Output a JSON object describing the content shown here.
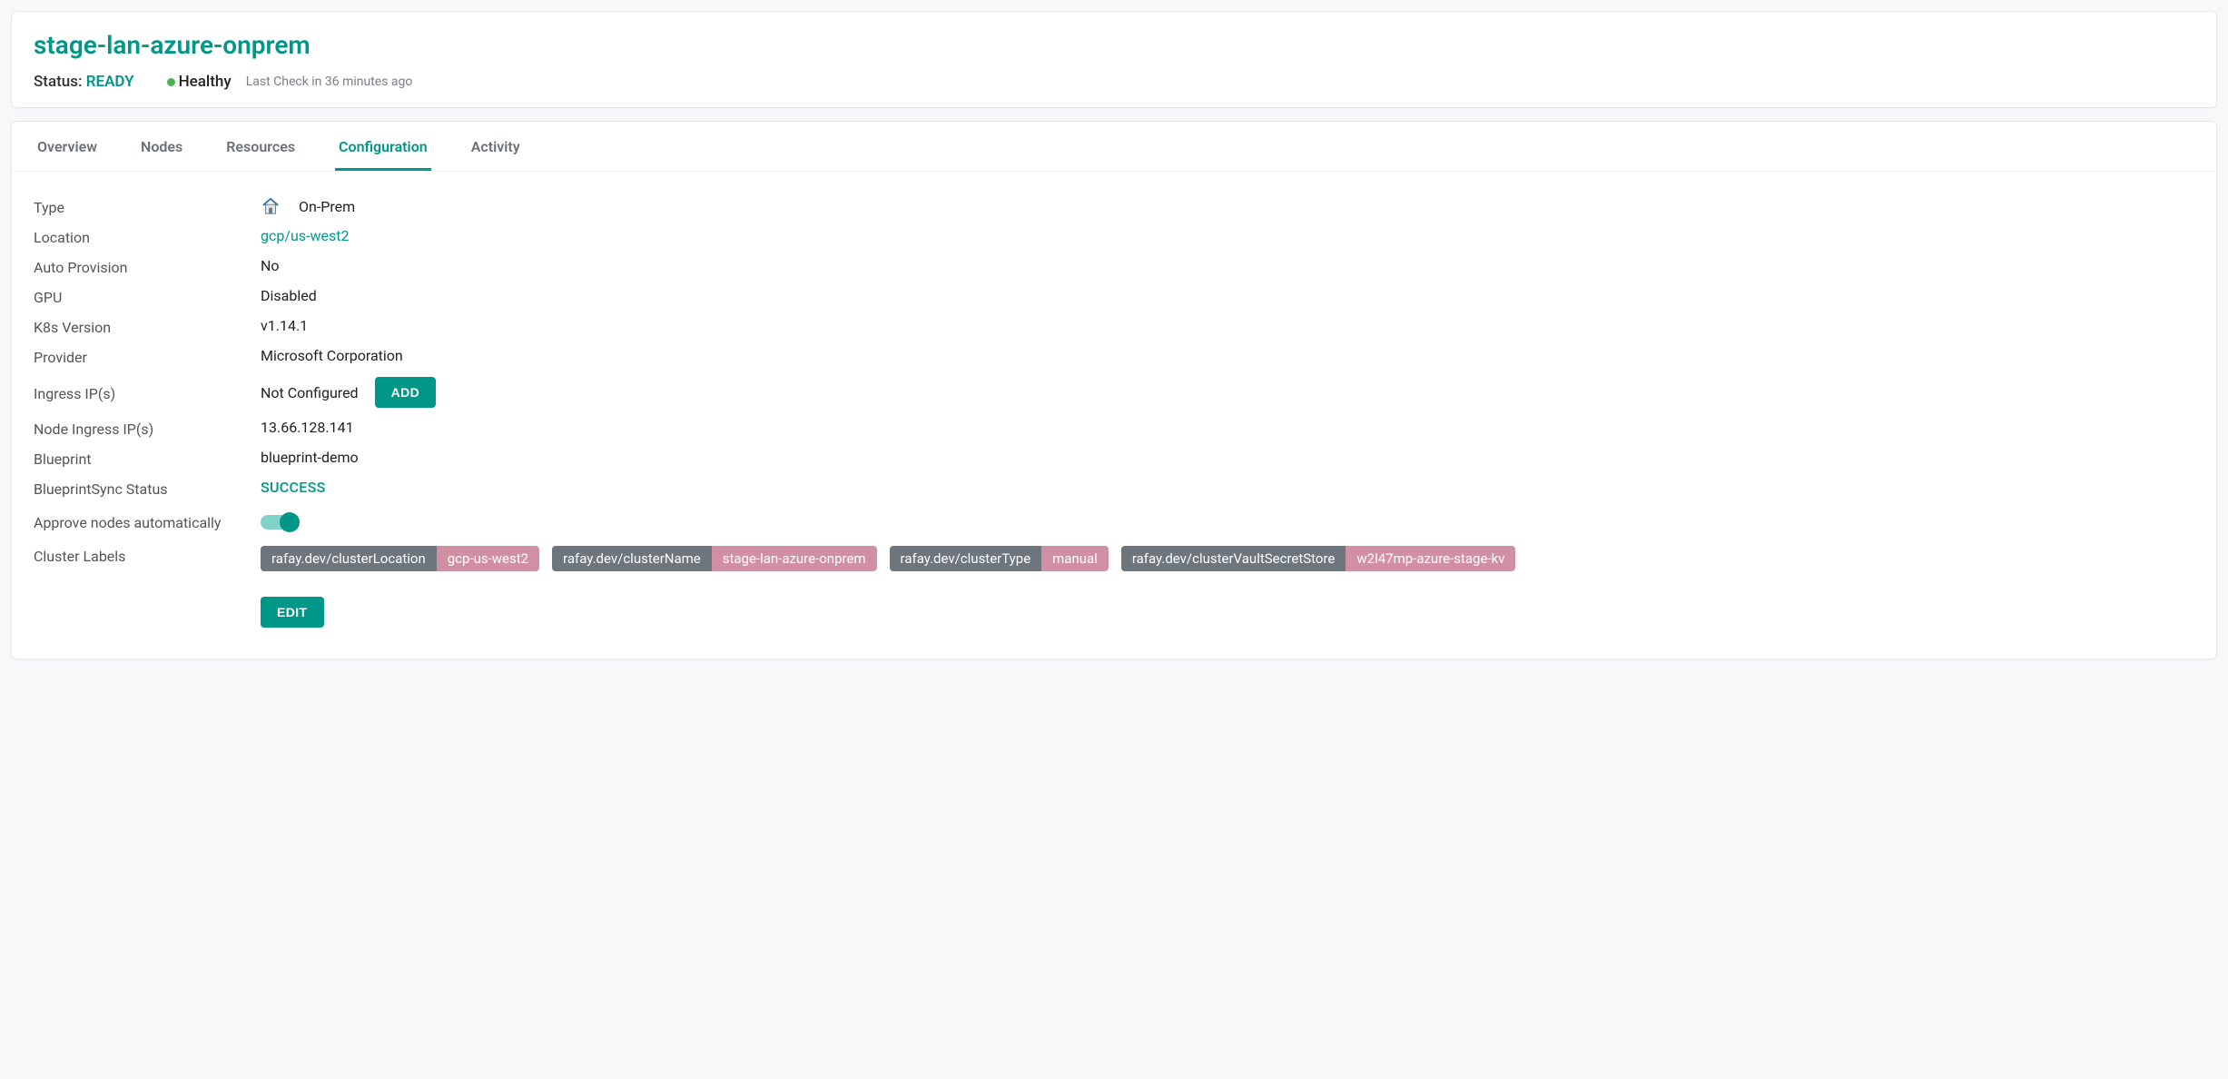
{
  "header": {
    "clusterName": "stage-lan-azure-onprem",
    "statusLabel": "Status:",
    "statusValue": "READY",
    "healthText": "Healthy",
    "lastCheck": "Last Check in 36 minutes ago"
  },
  "tabs": {
    "overview": "Overview",
    "nodes": "Nodes",
    "resources": "Resources",
    "configuration": "Configuration",
    "activity": "Activity"
  },
  "config": {
    "typeLabel": "Type",
    "typeValue": "On-Prem",
    "locationLabel": "Location",
    "locationValue": "gcp/us-west2",
    "autoProvisionLabel": "Auto Provision",
    "autoProvisionValue": "No",
    "gpuLabel": "GPU",
    "gpuValue": "Disabled",
    "k8sLabel": "K8s Version",
    "k8sValue": "v1.14.1",
    "providerLabel": "Provider",
    "providerValue": "Microsoft Corporation",
    "ingressLabel": "Ingress IP(s)",
    "ingressValue": "Not Configured",
    "addButton": "ADD",
    "nodeIngressLabel": "Node Ingress IP(s)",
    "nodeIngressValue": "13.66.128.141",
    "blueprintLabel": "Blueprint",
    "blueprintValue": "blueprint-demo",
    "blueprintSyncLabel": "BlueprintSync Status",
    "blueprintSyncValue": "SUCCESS",
    "approveNodesLabel": "Approve nodes automatically",
    "clusterLabelsLabel": "Cluster Labels",
    "editButton": "EDIT",
    "labels": {
      "l0k": "rafay.dev/clusterLocation",
      "l0v": "gcp-us-west2",
      "l1k": "rafay.dev/clusterName",
      "l1v": "stage-lan-azure-onprem",
      "l2k": "rafay.dev/clusterType",
      "l2v": "manual",
      "l3k": "rafay.dev/clusterVaultSecretStore",
      "l3v": "w2l47mp-azure-stage-kv"
    }
  }
}
